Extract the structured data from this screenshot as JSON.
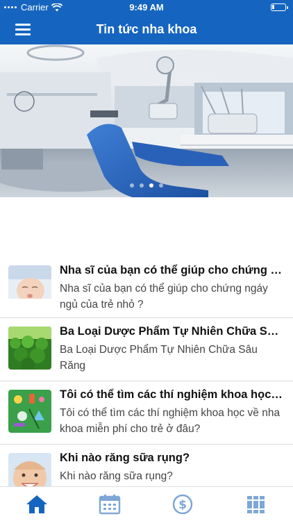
{
  "status_bar": {
    "carrier": "Carrier",
    "time": "9:49 AM"
  },
  "header": {
    "title": "Tin tức nha khoa",
    "menu_icon": "menu-icon"
  },
  "banner": {
    "image": "dental-clinic-photo",
    "pages": 4,
    "active_page": 3
  },
  "colors": {
    "primary": "#1565c0",
    "tab_inactive": "#7fa7d6"
  },
  "articles": [
    {
      "title": "Nha sĩ của bạn có thể giúp cho chứng ngáy ngủ của trẻ nhỏ ?",
      "description": "Nha sĩ của bạn có thể giúp cho chứng ngáy ngủ của trẻ nhỏ ?"
    },
    {
      "title": "Ba Loại Dược Phẩm Tự Nhiên Chữa Sâu Răng",
      "description": "Ba Loại Dược Phẩm Tự Nhiên Chữa Sâu Răng"
    },
    {
      "title": "Tôi có thể tìm các thí nghiệm khoa học về nha khoa miễn phí cho trẻ ở đâu?",
      "description": "Tôi có thể tìm các thí nghiệm khoa học về nha khoa miễn phí cho trẻ ở đâu?"
    },
    {
      "title": "Khi nào răng sữa rụng?",
      "description": "Khi nào răng sữa rụng?"
    }
  ],
  "tabs": [
    {
      "icon": "home-icon",
      "active": true
    },
    {
      "icon": "calendar-icon",
      "active": false
    },
    {
      "icon": "dollar-icon",
      "active": false
    },
    {
      "icon": "books-icon",
      "active": false
    }
  ]
}
